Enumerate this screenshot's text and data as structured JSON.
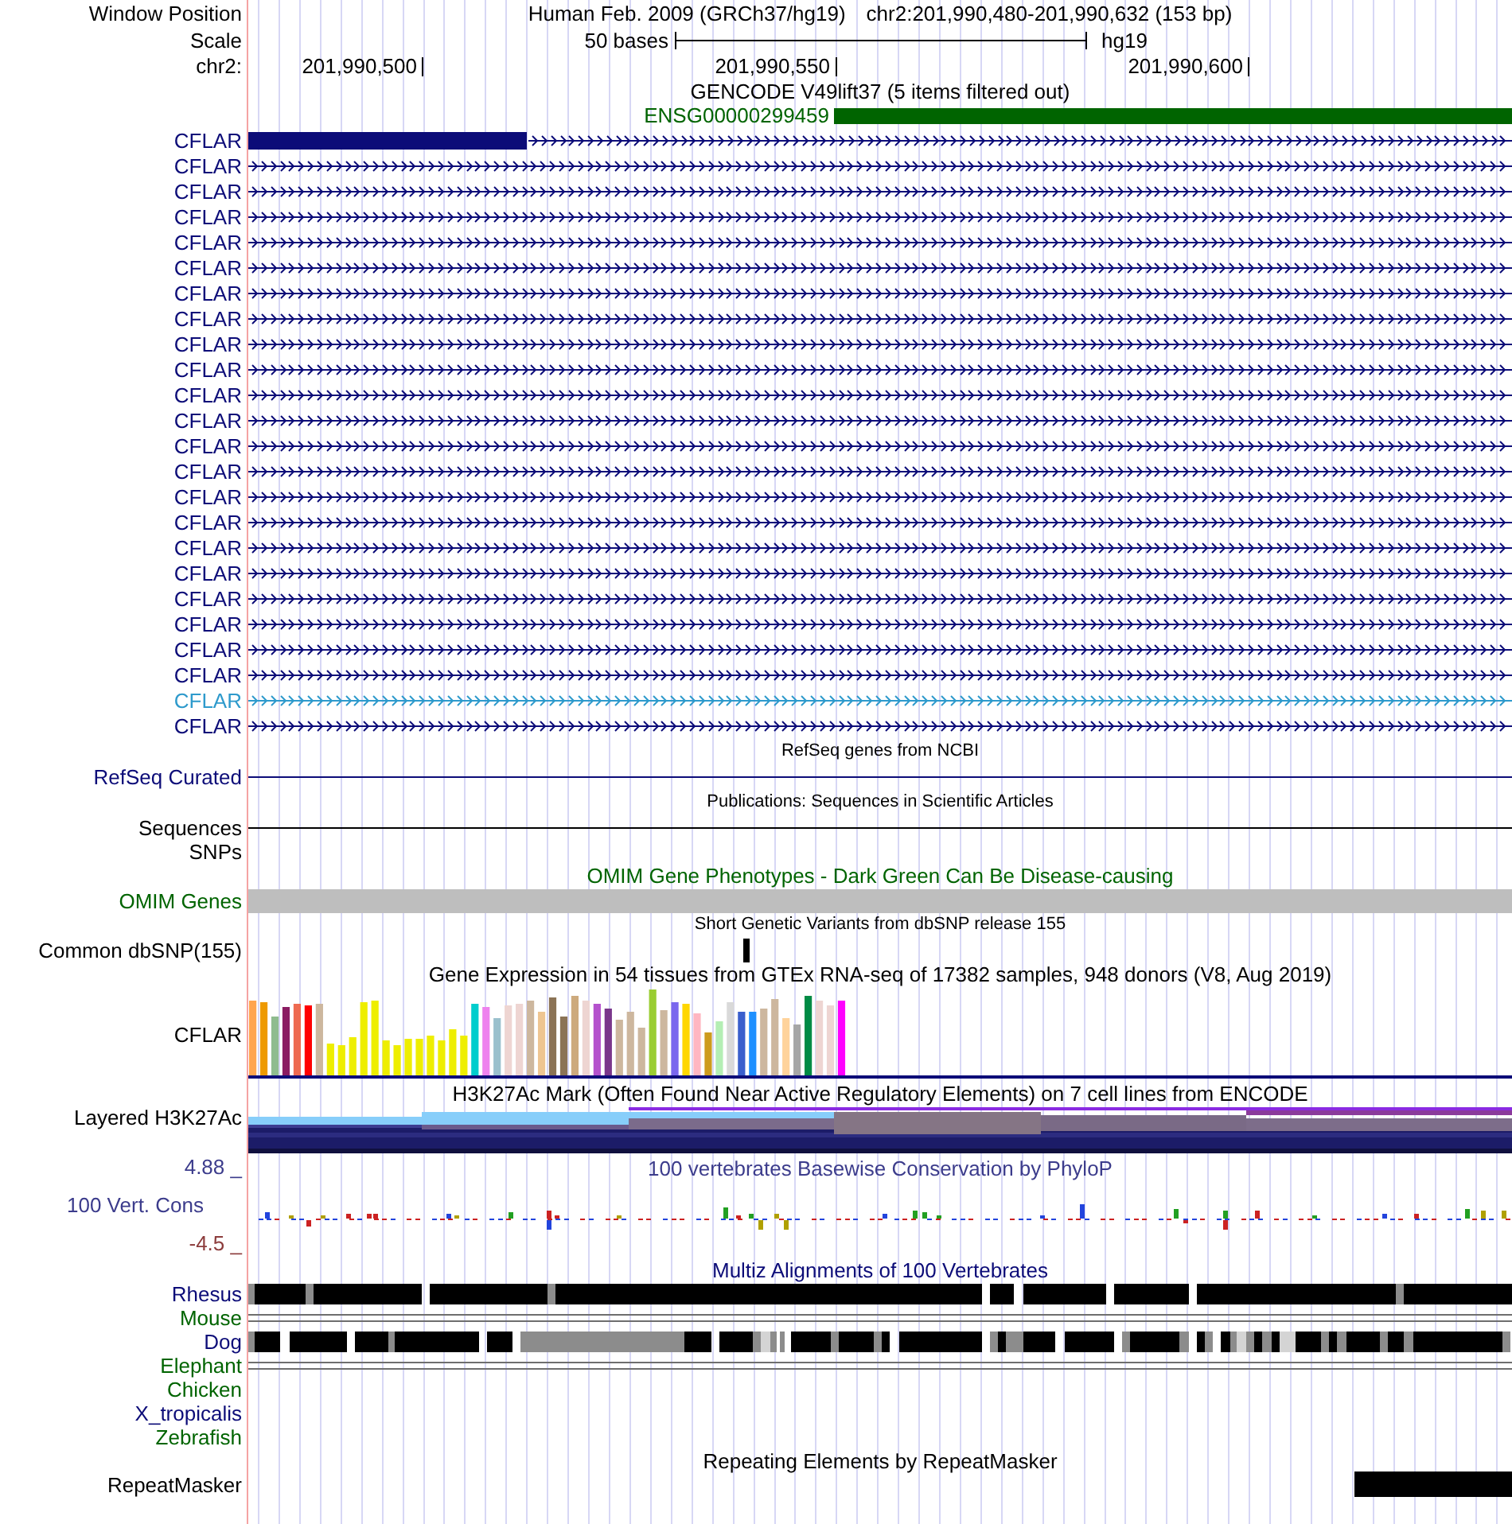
{
  "header": {
    "label": "Window Position",
    "assembly": "Human Feb. 2009 (GRCh37/hg19)",
    "position": "chr2:201,990,480-201,990,632 (153 bp)"
  },
  "scale": {
    "label": "Scale",
    "length": "50 bases",
    "assembly": "hg19"
  },
  "ruler": {
    "label": "chr2:",
    "ticks": [
      "201,990,500",
      "201,990,550",
      "201,990,600"
    ]
  },
  "gencode": {
    "title": "GENCODE V49lift37 (5 items filtered out)",
    "gene": "ENSG00000299459",
    "transcripts": [
      {
        "name": "CFLAR",
        "kind": "exon-start",
        "color": "#0c0c78"
      },
      {
        "name": "CFLAR",
        "kind": "intron",
        "color": "#0c0c78"
      },
      {
        "name": "CFLAR",
        "kind": "intron",
        "color": "#0c0c78"
      },
      {
        "name": "CFLAR",
        "kind": "intron",
        "color": "#0c0c78"
      },
      {
        "name": "CFLAR",
        "kind": "intron",
        "color": "#0c0c78"
      },
      {
        "name": "CFLAR",
        "kind": "intron",
        "color": "#0c0c78"
      },
      {
        "name": "CFLAR",
        "kind": "intron",
        "color": "#0c0c78"
      },
      {
        "name": "CFLAR",
        "kind": "intron",
        "color": "#0c0c78"
      },
      {
        "name": "CFLAR",
        "kind": "intron",
        "color": "#0c0c78"
      },
      {
        "name": "CFLAR",
        "kind": "intron",
        "color": "#0c0c78"
      },
      {
        "name": "CFLAR",
        "kind": "intron",
        "color": "#0c0c78"
      },
      {
        "name": "CFLAR",
        "kind": "intron",
        "color": "#0c0c78"
      },
      {
        "name": "CFLAR",
        "kind": "intron",
        "color": "#0c0c78"
      },
      {
        "name": "CFLAR",
        "kind": "intron",
        "color": "#0c0c78"
      },
      {
        "name": "CFLAR",
        "kind": "intron",
        "color": "#0c0c78"
      },
      {
        "name": "CFLAR",
        "kind": "intron",
        "color": "#0c0c78"
      },
      {
        "name": "CFLAR",
        "kind": "intron",
        "color": "#0c0c78"
      },
      {
        "name": "CFLAR",
        "kind": "intron",
        "color": "#0c0c78"
      },
      {
        "name": "CFLAR",
        "kind": "intron",
        "color": "#0c0c78"
      },
      {
        "name": "CFLAR",
        "kind": "intron",
        "color": "#0c0c78"
      },
      {
        "name": "CFLAR",
        "kind": "intron",
        "color": "#0c0c78"
      },
      {
        "name": "CFLAR",
        "kind": "intron",
        "color": "#0c0c78"
      },
      {
        "name": "CFLAR",
        "kind": "intron",
        "color": "#2e9acc"
      },
      {
        "name": "CFLAR",
        "kind": "intron",
        "color": "#0c0c78"
      }
    ]
  },
  "tracks": [
    {
      "kind": "line",
      "title": "RefSeq genes from NCBI",
      "label": "RefSeq Curated",
      "color": "#0c0c78"
    },
    {
      "kind": "line",
      "title": "Publications: Sequences in Scientific Articles",
      "label": "Sequences",
      "color": "#000000"
    },
    {
      "kind": "empty",
      "label": "SNPs",
      "color": "#000000"
    },
    {
      "kind": "bar",
      "title": "OMIM Gene Phenotypes - Dark Green Can Be Disease-causing",
      "label": "OMIM Genes",
      "color": "#006400"
    },
    {
      "kind": "variant",
      "title": "Short Genetic Variants from dbSNP release 155",
      "label": "Common dbSNP(155)",
      "color": "#000000"
    },
    {
      "kind": "expression",
      "title": "Gene Expression in 54 tissues from GTEx RNA-seq of 17382 samples, 948 donors (V8, Aug 2019)",
      "label": "CFLAR",
      "color": "#000000"
    },
    {
      "kind": "layered",
      "title": "H3K27Ac Mark (Often Found Near Active Regulatory Elements) on 7 cell lines from ENCODE",
      "label": "Layered H3K27Ac",
      "color": "#000000"
    },
    {
      "kind": "conservation",
      "title": "100 vertebrates Basewise Conservation by PhyloP",
      "label": "100 Vert. Cons",
      "max": "4.88 _",
      "min": "-4.5 _",
      "color": "#3c3c8c"
    },
    {
      "kind": "alignment",
      "title": "Multiz Alignments of 100 Vertebrates",
      "color": "#0c0c78",
      "species": [
        {
          "name": "Rhesus",
          "kind": "blocks",
          "color": "#0c0c78"
        },
        {
          "name": "Mouse",
          "kind": "double-line",
          "color": "#006400"
        },
        {
          "name": "Dog",
          "kind": "blocks",
          "color": "#0c0c78"
        },
        {
          "name": "Elephant",
          "kind": "double-line",
          "color": "#006400"
        },
        {
          "name": "Chicken",
          "kind": "none",
          "color": "#006400"
        },
        {
          "name": "X_tropicalis",
          "kind": "none",
          "color": "#0c0c78"
        },
        {
          "name": "Zebrafish",
          "kind": "none",
          "color": "#006400"
        }
      ]
    },
    {
      "kind": "repeat",
      "title": "Repeating Elements by RepeatMasker",
      "label": "RepeatMasker",
      "color": "#000000"
    }
  ]
}
